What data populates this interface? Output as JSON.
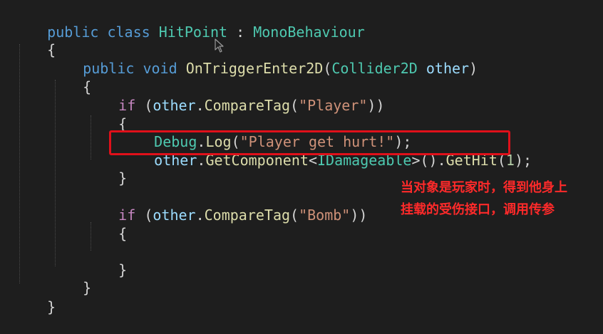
{
  "code": {
    "line1": {
      "kw1": "public",
      "kw2": "class",
      "cls": "HitPoint",
      "colon": ":",
      "base": "MonoBehaviour"
    },
    "line2": {
      "brace": "{"
    },
    "line3": {
      "kw1": "public",
      "kw2": "void",
      "method": "OnTriggerEnter2D",
      "open": "(",
      "type": "Collider2D",
      "param": "other",
      "close": ")"
    },
    "line4": {
      "brace": "{"
    },
    "line5": {
      "kw": "if",
      "open": "(",
      "obj": "other",
      "dot": ".",
      "method": "CompareTag",
      "popen": "(",
      "str": "\"Player\"",
      "close": "))"
    },
    "line6": {
      "brace": "{"
    },
    "line7": {
      "cls": "Debug",
      "dot": ".",
      "method": "Log",
      "popen": "(",
      "str": "\"Player get hurt!\"",
      "close": ");"
    },
    "line8": {
      "obj": "other",
      "dot": ".",
      "method": "GetComponent",
      "lt": "<",
      "type": "IDamageable",
      "gt": ">",
      "call": "().",
      "method2": "GetHit",
      "popen": "(",
      "num": "1",
      "close": ");"
    },
    "line9": {
      "brace": "}"
    },
    "line10": {
      "kw": "if",
      "open": "(",
      "obj": "other",
      "dot": ".",
      "method": "CompareTag",
      "popen": "(",
      "str": "\"Bomb\"",
      "close": "))"
    },
    "line11": {
      "brace": "{"
    },
    "line12": {
      "brace": "}"
    },
    "line13": {
      "brace": "}"
    },
    "line14": {
      "brace": "}"
    }
  },
  "annotation": {
    "line1": "当对象是玩家时，得到他身上",
    "line2": "挂载的受伤接口，调用传参"
  },
  "colors": {
    "keyword": "#569cd6",
    "class": "#4ec9b0",
    "method": "#dcdcaa",
    "identifier": "#9cdcfe",
    "string": "#ce9178",
    "number": "#b5cea8",
    "control": "#c586c0",
    "highlight": "#e0101a",
    "annotation": "#ff2a2a"
  },
  "icons": {
    "cursor": "mouse-pointer-icon"
  }
}
